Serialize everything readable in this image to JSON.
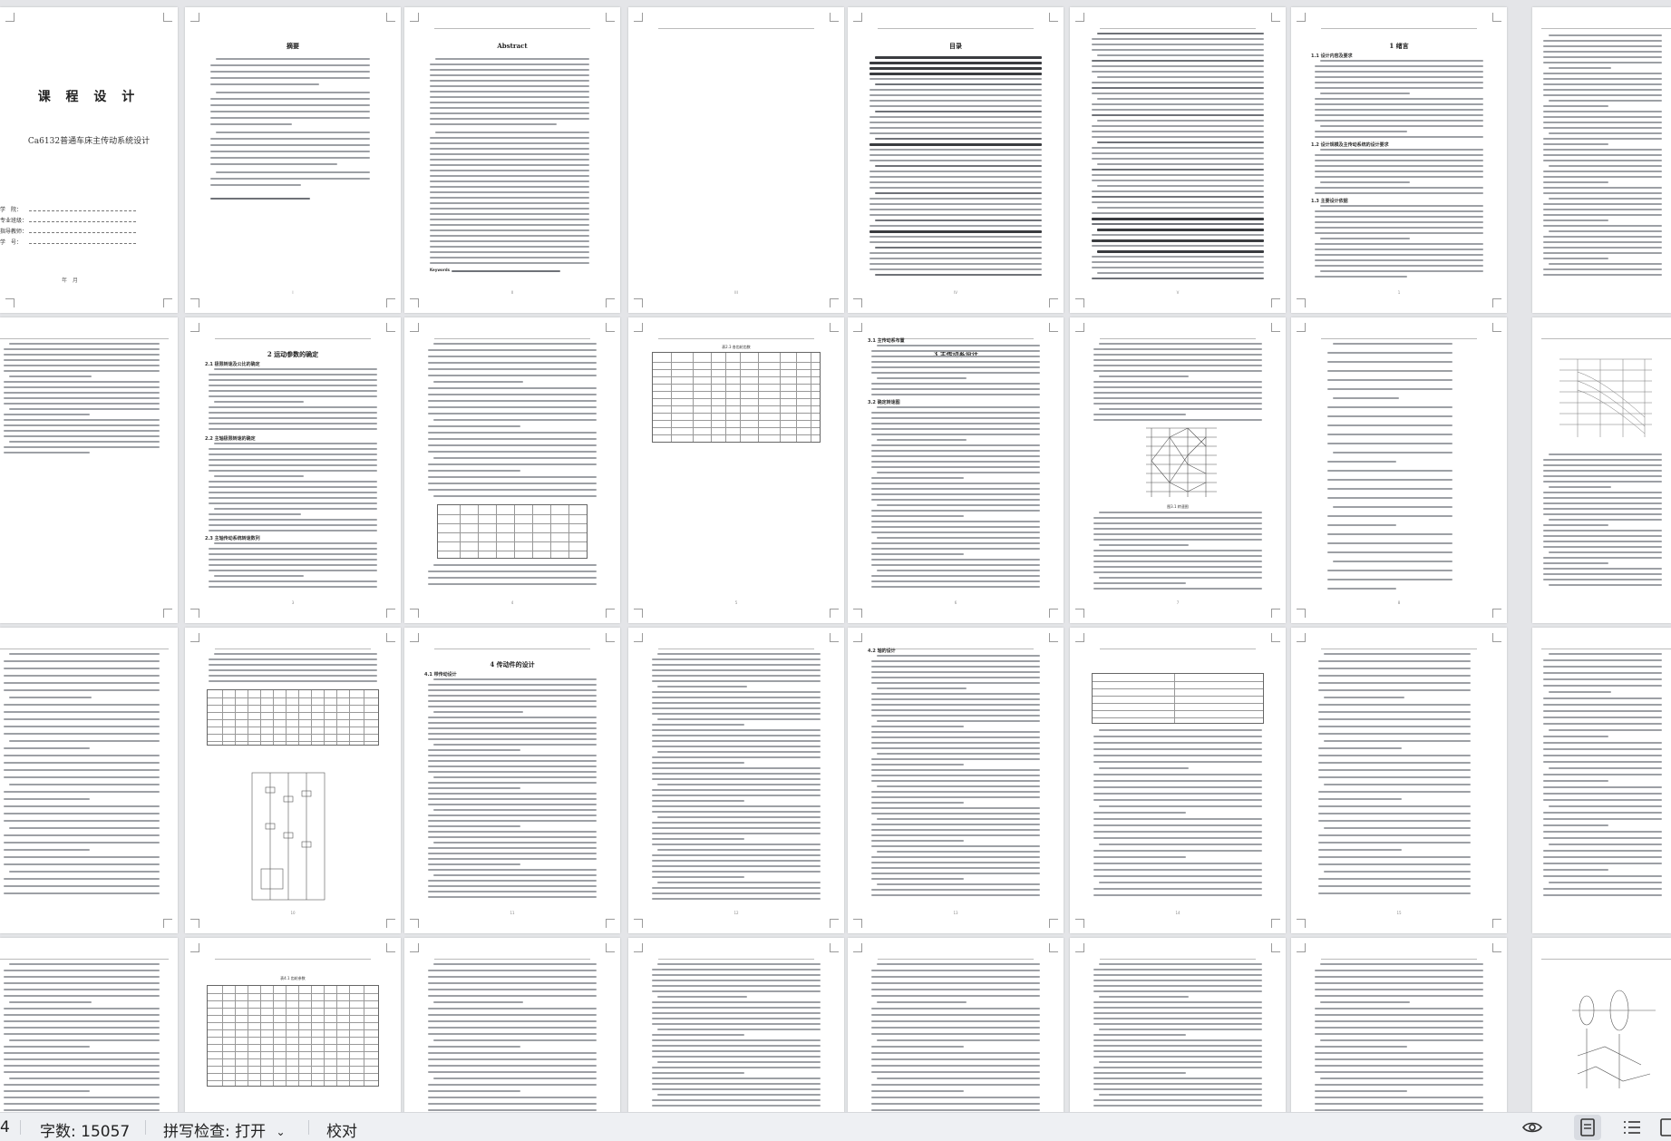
{
  "pages": {
    "cover": {
      "title": "课 程 设 计",
      "subtitle": "Ca6132普通车床主传动系统设计",
      "fields": [
        "学　院：",
        "专业班级：",
        "指导教师：",
        "学　号："
      ],
      "date_label": "年　月"
    },
    "abstract_cn": {
      "title": "摘要"
    },
    "abstract_en": {
      "title": "Abstract",
      "keywords_label": "Keywords"
    },
    "toc": {
      "title": "目录"
    },
    "ch1": {
      "title": "1  绪言",
      "h1": "1.1  设计内容及要求",
      "h2": "1.2  设计规模及主传动系统的设计要求",
      "h3": "1.3  主要设计依据"
    },
    "ch2": {
      "title": "2  运动参数的确定",
      "h1": "2.1  极限转速及公比的确定",
      "h2": "2.2  主轴极限转速的确定",
      "h3": "2.3  主轴传动系统转速数列"
    },
    "ch3": {
      "title": "3  主传动系设计",
      "h1": "3.1  主传动系布置",
      "h2": "3.2  确定转速图"
    },
    "ch4": {
      "title": "4  传动件的设计",
      "h1": "4.1  带传动设计",
      "h2": "4.2  轴的设计"
    },
    "table_caption_1": "表2.3  各齿轮齿数",
    "table_caption_2": "表4.1  齿轮参数",
    "fig_caption_1": "图3.1  转速图"
  },
  "statusbar": {
    "page_indicator": "4",
    "word_count": "字数: 15057",
    "spell_check": "拼写检查: 打开",
    "proofread": "校对"
  }
}
